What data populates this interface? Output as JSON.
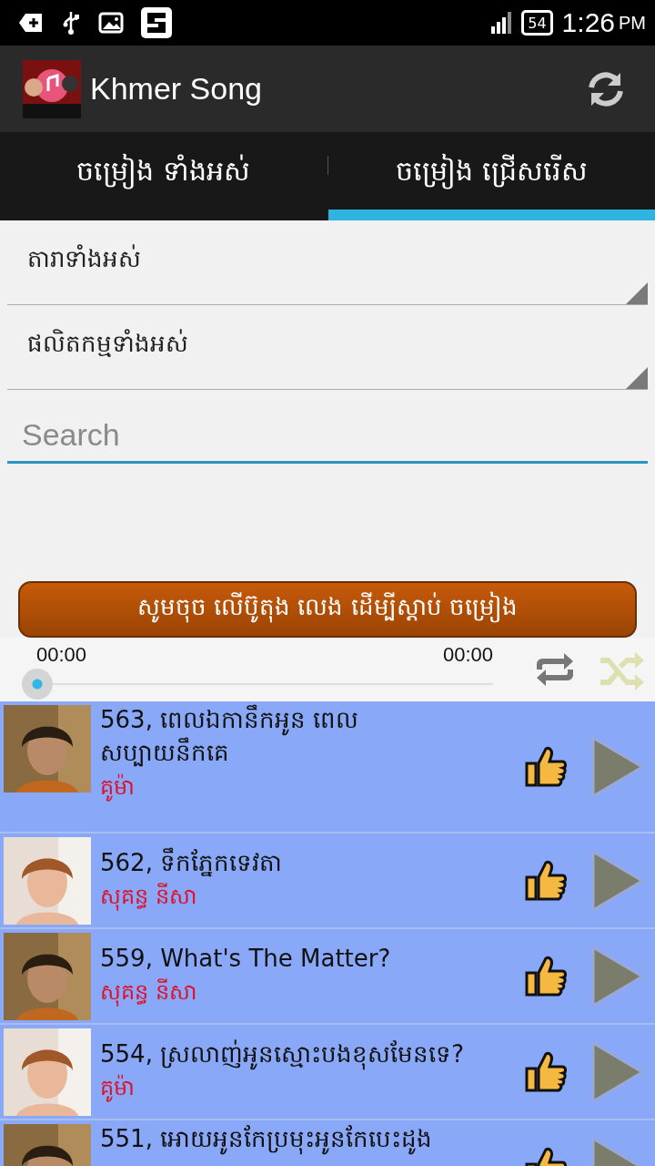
{
  "status_bar": {
    "battery": "54",
    "time": "1:26",
    "meridiem": "PM"
  },
  "app_bar": {
    "title": "Khmer Song"
  },
  "tabs": [
    {
      "label": "ចម្រៀង ទាំងអស់",
      "selected": false
    },
    {
      "label": "ចម្រៀង ជ្រើសរើស",
      "selected": true
    }
  ],
  "filters": [
    {
      "value": "តារាទាំងអស់"
    },
    {
      "value": "ផលិតកម្មទាំងអស់"
    }
  ],
  "search": {
    "placeholder": "Search"
  },
  "play_hint_button": "សូមចុច លើប៊ូតុង លេង ដើម្បីស្តាប់ ចម្រៀង",
  "player": {
    "elapsed": "00:00",
    "duration": "00:00",
    "level": 0,
    "repeat_on": true,
    "shuffle_on": false
  },
  "songs": [
    {
      "title": "563, ពេលឯកានឹកអូន ពេលសប្បាយនឹកគេ",
      "artist": "គូម៉ា"
    },
    {
      "title": "562, ទឹកភ្នែកទេវតា",
      "artist": "សុគន្ធ នីសា"
    },
    {
      "title": "559, What's The Matter?",
      "artist": "សុគន្ធ នីសា"
    },
    {
      "title": "554, ស្រលាញ់អូនស្មោះបងខុសមែនទេ?",
      "artist": "គូម៉ា"
    },
    {
      "title": "551, អោយអូនកែប្រមុះអូនកែបេះដូង"
    }
  ]
}
